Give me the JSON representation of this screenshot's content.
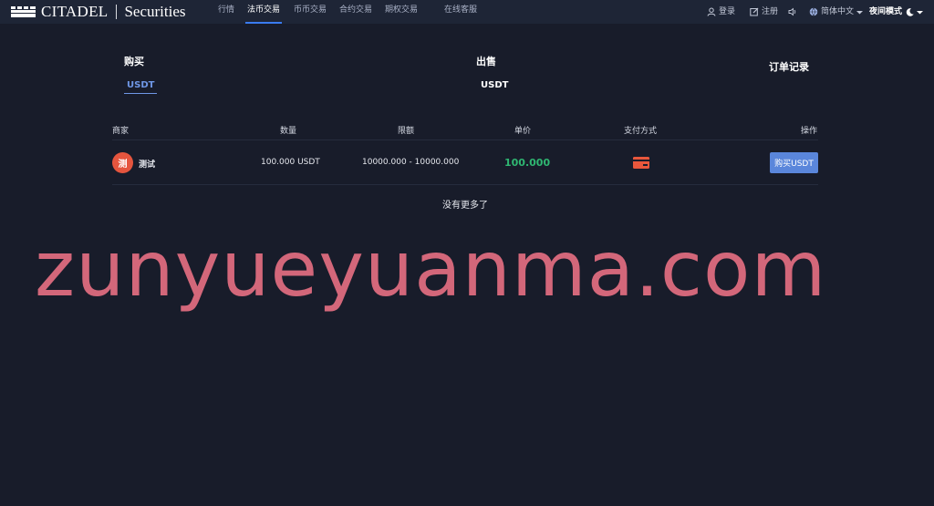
{
  "header": {
    "logo": {
      "brand": "CITADEL",
      "suffix": "Securities"
    },
    "nav": [
      {
        "label": "行情",
        "active": false
      },
      {
        "label": "法币交易",
        "active": true
      },
      {
        "label": "币币交易",
        "active": false
      },
      {
        "label": "合约交易",
        "active": false
      },
      {
        "label": "期权交易",
        "active": false
      },
      {
        "label": "在线客服",
        "active": false
      }
    ],
    "login_label": "登录",
    "register_label": "注册",
    "language_label": "简体中文",
    "theme_label": "夜间模式"
  },
  "trade": {
    "buy_title": "购买",
    "buy_coin": "USDT",
    "sell_title": "出售",
    "sell_coin": "USDT",
    "orders_link": "订单记录"
  },
  "table": {
    "headers": [
      "商家",
      "数量",
      "限额",
      "单价",
      "支付方式",
      "操作"
    ],
    "rows": [
      {
        "avatar_char": "测",
        "merchant": "测试",
        "quantity": "100.000 USDT",
        "limit": "10000.000 - 10000.000",
        "price": "100.000",
        "payment_icon": "bank-card-icon",
        "action": "购买USDT"
      }
    ],
    "footer": "没有更多了"
  },
  "watermark": "zunyueyuanma.com",
  "colors": {
    "background": "#181c2a",
    "header": "#1e2536",
    "accent": "#3a7bf0",
    "button": "#5a86db",
    "price": "#2fb772",
    "payment": "#e8573c",
    "watermark": "#d3677a"
  }
}
